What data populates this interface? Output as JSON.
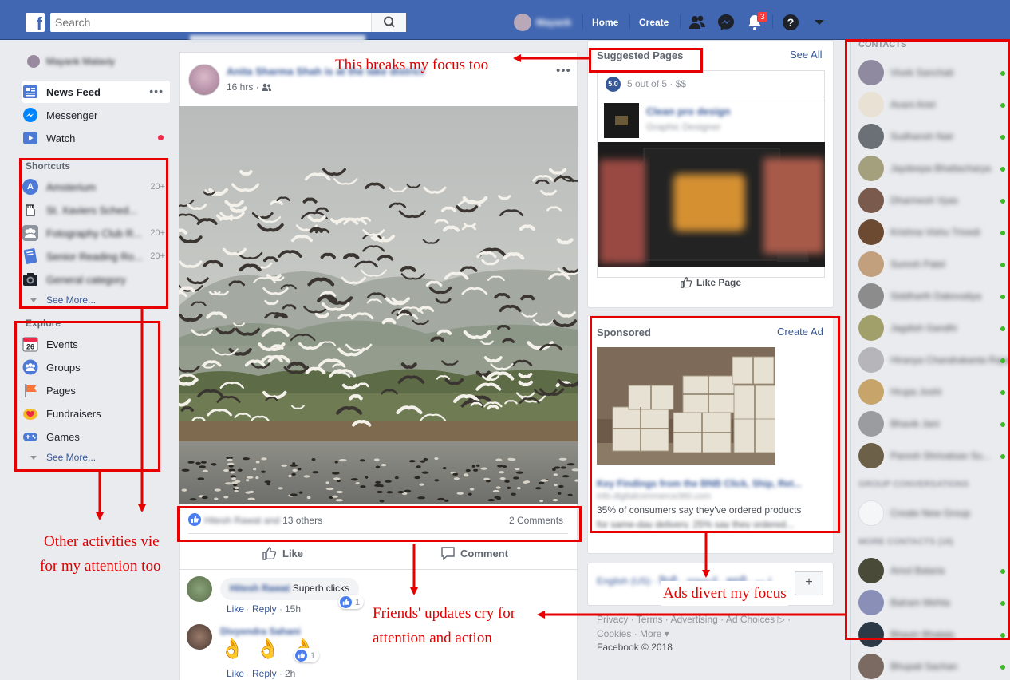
{
  "topbar": {
    "logo": "f",
    "search_placeholder": "Search",
    "profile_name": "Mayank",
    "home": "Home",
    "create": "Create",
    "notification_count": "3"
  },
  "left": {
    "user_name": "Mayank Malaviy",
    "nav": [
      {
        "label": "News Feed"
      },
      {
        "label": "Messenger"
      },
      {
        "label": "Watch"
      }
    ],
    "shortcuts_title": "Shortcuts",
    "shortcuts": [
      {
        "label": "Amsterium",
        "count": "20+"
      },
      {
        "label": "St. Xaviers Sched...",
        "count": ""
      },
      {
        "label": "Fotography Club R...",
        "count": "20+"
      },
      {
        "label": "Senior Reading Ro...",
        "count": "20+"
      },
      {
        "label": "General category",
        "count": ""
      }
    ],
    "see_more": "See More...",
    "explore_title": "Explore",
    "explore": [
      {
        "label": "Events",
        "icon_num": "26"
      },
      {
        "label": "Groups"
      },
      {
        "label": "Pages"
      },
      {
        "label": "Fundraisers"
      },
      {
        "label": "Games"
      }
    ],
    "explore_see_more": "See More..."
  },
  "post": {
    "author": "Anita Sharma Shah is at the lake district",
    "time": "16 hrs",
    "reactions_name": "Hitesh Rawat and",
    "reactions_others": "13 others",
    "comments_count": "2 Comments",
    "like": "Like",
    "comment": "Comment",
    "comments": [
      {
        "name": "Hitesh Rawat",
        "text": "Superb clicks",
        "like_count": "1",
        "actions": [
          "Like",
          "Reply"
        ],
        "time": "15h"
      },
      {
        "name": "Divyendra Sahani",
        "emoji": "👌 👌 👌",
        "like_count": "1",
        "actions": [
          "Like",
          "Reply"
        ],
        "time": "2h"
      }
    ]
  },
  "suggested": {
    "title": "Suggested Pages",
    "see_all": "See All",
    "rating": "5.0",
    "rating_text": "5 out of 5 · $$",
    "page_name": "Clean pro design",
    "page_category": "Graphic Designer",
    "like_page": "Like Page"
  },
  "sponsored": {
    "title": "Sponsored",
    "create_ad": "Create Ad",
    "ad_title": "Key Findings from the BNB Click, Ship, Ret...",
    "ad_url": "info.digitalcommerce360.com",
    "ad_text": "35% of consumers say they've ordered products",
    "ad_text2": "for same-day delivery. 25% say they ordered..."
  },
  "language": {
    "text": "English (US) · हिन्दी · ગુજરાતી · मराठी · اردو"
  },
  "footer": {
    "links": "Privacy · Terms · Advertising · Ad Choices ▷ ·",
    "links2": "Cookies · More ▾",
    "copyright": "Facebook © 2018"
  },
  "contacts": {
    "title": "CONTACTS",
    "list": [
      {
        "name": "Vivek Sanchati",
        "color": "#8f8aa0"
      },
      {
        "name": "Avani Ariel",
        "color": "#e9e2d4"
      },
      {
        "name": "Sudhansh Nair",
        "color": "#6b6f76"
      },
      {
        "name": "Jaydeepa Bhattacharya",
        "color": "#a4a07e"
      },
      {
        "name": "Dharmesh Vyas",
        "color": "#7a5a4c"
      },
      {
        "name": "Krishna Vishu Trivedi",
        "color": "#6c4a32"
      },
      {
        "name": "Suresh Patel",
        "color": "#c2a07e"
      },
      {
        "name": "Siddharth Dabovaliya",
        "color": "#8c8c8c"
      },
      {
        "name": "Jagdish Gandhi",
        "color": "#a2a06a"
      },
      {
        "name": "Hiranya Chandrakanta Rajan",
        "color": "#b6b6ba"
      },
      {
        "name": "Hrupa Joshi",
        "color": "#c7a46a"
      },
      {
        "name": "Bhavik Jani",
        "color": "#9a9ca0"
      },
      {
        "name": "Paresh Shrivatsav Su...",
        "color": "#6c6048"
      }
    ],
    "group_title": "GROUP CONVERSATIONS",
    "create_group": "Create New Group",
    "more_title": "MORE CONTACTS (18)",
    "more_list": [
      {
        "name": "Amol Balaria",
        "color": "#4a4a38"
      },
      {
        "name": "Balram Mehta",
        "color": "#8a8fb8"
      },
      {
        "name": "Bhavin Bhalala",
        "color": "#2c3a48"
      },
      {
        "name": "Bhupali Sachan",
        "color": "#7a6a62"
      }
    ]
  },
  "annotations": {
    "focus": "This breaks my focus too",
    "other_line1": "Other activities vie",
    "other_line2": "for my attention too",
    "ads": "Ads divert my focus",
    "friends_line1": "Friends' updates cry for",
    "friends_line2": "attention and action"
  }
}
